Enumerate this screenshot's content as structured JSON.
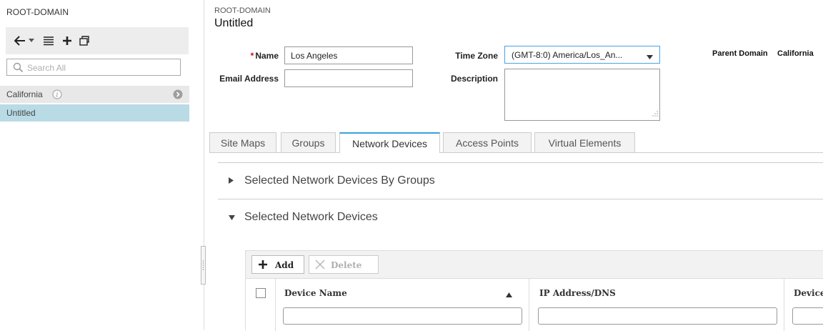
{
  "left_panel": {
    "title": "ROOT-DOMAIN",
    "toolbar_icons": [
      "back-arrow-icon",
      "chevron-down-icon",
      "list-icon",
      "plus-icon",
      "duplicate-icon"
    ],
    "search": {
      "placeholder": "Search All",
      "icon": "search-icon"
    },
    "tree": [
      {
        "label": "California",
        "icons": [
          "info-icon",
          "arrow-right-icon"
        ]
      },
      {
        "label": "Untitled",
        "selected": true
      }
    ]
  },
  "header": {
    "breadcrumb": "ROOT-DOMAIN",
    "title": "Untitled"
  },
  "form": {
    "name": {
      "label": "Name",
      "required_mark": "*",
      "value": "Los Angeles"
    },
    "email": {
      "label": "Email Address",
      "value": ""
    },
    "time_zone": {
      "label": "Time Zone",
      "value": "(GMT-8:0) America/Los_An..."
    },
    "description": {
      "label": "Description",
      "value": ""
    },
    "parent_domain": {
      "label": "Parent Domain",
      "value": "California"
    }
  },
  "tabs": [
    {
      "label": "Site Maps"
    },
    {
      "label": "Groups"
    },
    {
      "label": "Network Devices",
      "active": true
    },
    {
      "label": "Access Points"
    },
    {
      "label": "Virtual Elements"
    }
  ],
  "sections": {
    "by_groups": {
      "title": "Selected Network Devices By Groups",
      "expanded": false
    },
    "selected": {
      "title": "Selected Network Devices",
      "expanded": true
    }
  },
  "grid": {
    "toolbar": {
      "add_label": "Add",
      "delete_label": "Delete"
    },
    "columns": [
      "Device Name",
      "IP Address/DNS",
      "Device"
    ],
    "sort_column": "Device Name"
  },
  "colors": {
    "accent": "#36a3dc",
    "selected_row": "#b9dbe6",
    "required": "#d0021b"
  }
}
